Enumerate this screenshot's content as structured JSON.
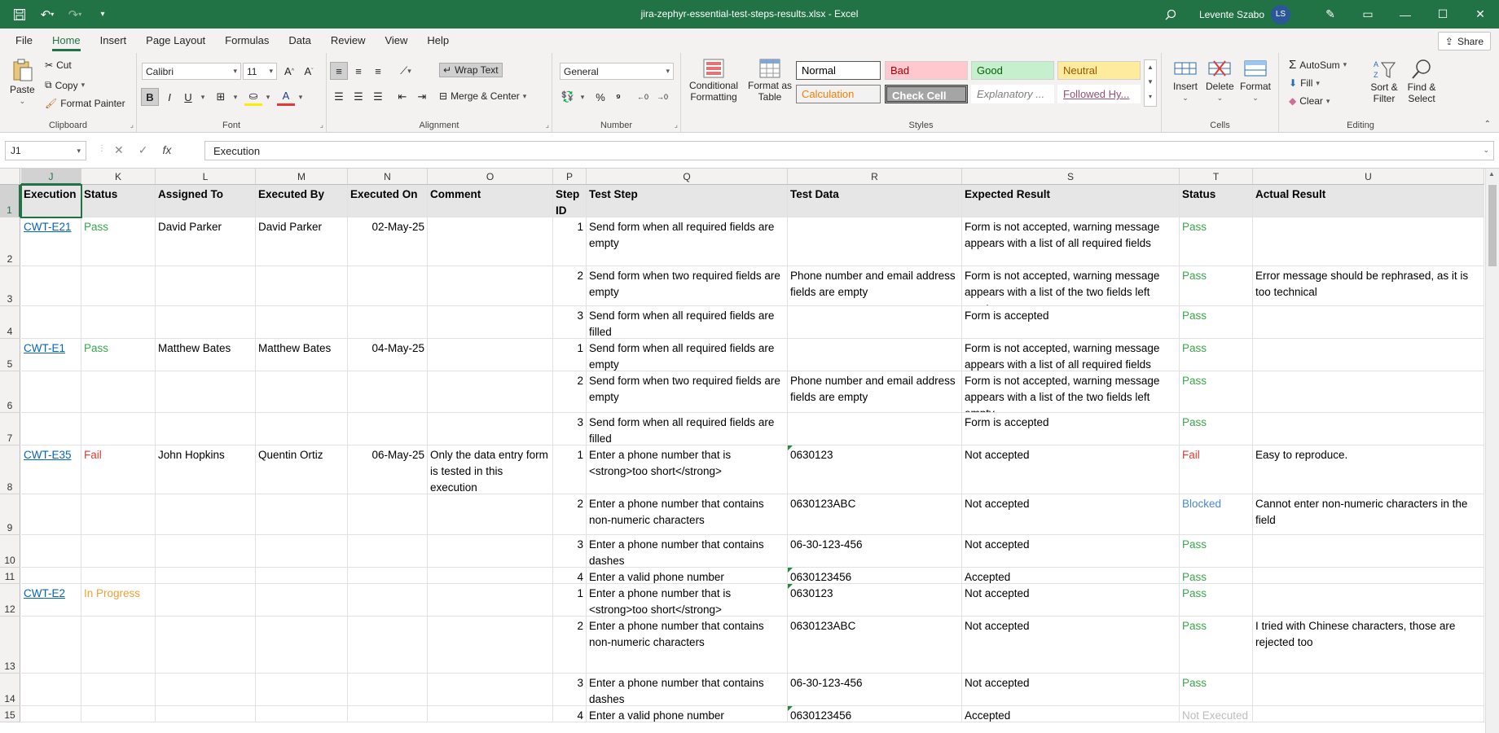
{
  "window": {
    "title": "jira-zephyr-essential-test-steps-results.xlsx  -  Excel",
    "user_name": "Levente Szabo",
    "user_initials": "LS"
  },
  "menu": {
    "tabs": [
      "File",
      "Home",
      "Insert",
      "Page Layout",
      "Formulas",
      "Data",
      "Review",
      "View",
      "Help"
    ],
    "active": "Home",
    "share_label": "Share"
  },
  "ribbon": {
    "clipboard": {
      "paste": "Paste",
      "cut": "Cut",
      "copy": "Copy",
      "format_painter": "Format Painter",
      "label": "Clipboard"
    },
    "font": {
      "family": "Calibri",
      "size": "11",
      "label": "Font"
    },
    "alignment": {
      "wrap_text": "Wrap Text",
      "merge_center": "Merge & Center",
      "label": "Alignment"
    },
    "number": {
      "format": "General",
      "label": "Number"
    },
    "styles": {
      "conditional_formatting": "Conditional Formatting",
      "format_as_table": "Format as Table",
      "normal": "Normal",
      "bad": "Bad",
      "good": "Good",
      "neutral": "Neutral",
      "calculation": "Calculation",
      "check_cell": "Check Cell",
      "explanatory": "Explanatory ...",
      "followed": "Followed Hy...",
      "label": "Styles"
    },
    "cells": {
      "insert": "Insert",
      "delete": "Delete",
      "format": "Format",
      "label": "Cells"
    },
    "editing": {
      "autosum": "AutoSum",
      "fill": "Fill",
      "clear": "Clear",
      "sort_filter": "Sort & Filter",
      "find_select": "Find & Select",
      "label": "Editing"
    }
  },
  "formula_bar": {
    "name_box": "J1",
    "content": "Execution"
  },
  "sheet": {
    "columns": [
      {
        "letter": "J",
        "header": "Execution"
      },
      {
        "letter": "K",
        "header": "Status"
      },
      {
        "letter": "L",
        "header": "Assigned To"
      },
      {
        "letter": "M",
        "header": "Executed By"
      },
      {
        "letter": "N",
        "header": "Executed On"
      },
      {
        "letter": "O",
        "header": "Comment"
      },
      {
        "letter": "P",
        "header": "Step ID"
      },
      {
        "letter": "Q",
        "header": "Test Step"
      },
      {
        "letter": "R",
        "header": "Test Data"
      },
      {
        "letter": "S",
        "header": "Expected Result"
      },
      {
        "letter": "T",
        "header": "Status"
      },
      {
        "letter": "U",
        "header": "Actual Result"
      }
    ],
    "rows": [
      {
        "num": "2",
        "J": "CWT-E21",
        "K": "Pass",
        "L": "David Parker",
        "M": "David Parker",
        "N": "02-May-25",
        "O": "",
        "P": "1",
        "Q": "Send form when all required fields are empty",
        "R": "",
        "S": "Form is not accepted, warning message appears with a list of all required fields",
        "T": "Pass",
        "U": ""
      },
      {
        "num": "3",
        "J": "",
        "K": "",
        "L": "",
        "M": "",
        "N": "",
        "O": "",
        "P": "2",
        "Q": "Send form when two required fields are empty",
        "R": "Phone number and email address fields are empty",
        "S": "Form is not accepted, warning message appears with a list of the two fields left empty",
        "T": "Pass",
        "U": "Error message should be rephrased, as it is too technical"
      },
      {
        "num": "4",
        "J": "",
        "K": "",
        "L": "",
        "M": "",
        "N": "",
        "O": "",
        "P": "3",
        "Q": "Send form when all required fields are filled",
        "R": "",
        "S": "Form is accepted",
        "T": "Pass",
        "U": ""
      },
      {
        "num": "5",
        "J": "CWT-E1",
        "K": "Pass",
        "L": "Matthew Bates",
        "M": "Matthew Bates",
        "N": "04-May-25",
        "O": "",
        "P": "1",
        "Q": "Send form when all required fields are empty",
        "R": "",
        "S": "Form is not accepted, warning message appears with a list of all required fields",
        "T": "Pass",
        "U": ""
      },
      {
        "num": "6",
        "J": "",
        "K": "",
        "L": "",
        "M": "",
        "N": "",
        "O": "",
        "P": "2",
        "Q": "Send form when two required fields are empty",
        "R": "Phone number and email address fields are empty",
        "S": "Form is not accepted, warning message appears with a list of the two fields left empty",
        "T": "Pass",
        "U": ""
      },
      {
        "num": "7",
        "J": "",
        "K": "",
        "L": "",
        "M": "",
        "N": "",
        "O": "",
        "P": "3",
        "Q": "Send form when all required fields are filled",
        "R": "",
        "S": "Form is accepted",
        "T": "Pass",
        "U": ""
      },
      {
        "num": "8",
        "J": "CWT-E35",
        "K": "Fail",
        "L": "John Hopkins",
        "M": "Quentin Ortiz",
        "N": "06-May-25",
        "O": "Only the data entry form is tested in this execution",
        "P": "1",
        "Q": "Enter a phone number that is <strong>too short</strong>",
        "R": "0630123",
        "S": "Not accepted",
        "T": "Fail",
        "U": "Easy to reproduce."
      },
      {
        "num": "9",
        "J": "",
        "K": "",
        "L": "",
        "M": "",
        "N": "",
        "O": "",
        "P": "2",
        "Q": "Enter a phone number that contains non-numeric characters",
        "R": "0630123ABC",
        "S": "Not accepted",
        "T": "Blocked",
        "U": "Cannot enter non-numeric characters in the field"
      },
      {
        "num": "10",
        "J": "",
        "K": "",
        "L": "",
        "M": "",
        "N": "",
        "O": "",
        "P": "3",
        "Q": "Enter a phone number that contains dashes",
        "R": "06-30-123-456",
        "S": "Not accepted",
        "T": "Pass",
        "U": ""
      },
      {
        "num": "11",
        "J": "",
        "K": "",
        "L": "",
        "M": "",
        "N": "",
        "O": "",
        "P": "4",
        "Q": "Enter a valid phone number",
        "R": "0630123456",
        "S": "Accepted",
        "T": "Pass",
        "U": ""
      },
      {
        "num": "12",
        "J": "CWT-E2",
        "K": "In Progress",
        "L": "",
        "M": "",
        "N": "",
        "O": "",
        "P": "1",
        "Q": "Enter a phone number that is <strong>too short</strong>",
        "R": "0630123",
        "S": "Not accepted",
        "T": "Pass",
        "U": ""
      },
      {
        "num": "13",
        "J": "",
        "K": "",
        "L": "",
        "M": "",
        "N": "",
        "O": "",
        "P": "2",
        "Q": "Enter a phone number that contains non-numeric characters",
        "R": "0630123ABC",
        "S": "Not accepted",
        "T": "Pass",
        "U": "I tried with Chinese characters, those are rejected too"
      },
      {
        "num": "14",
        "J": "",
        "K": "",
        "L": "",
        "M": "",
        "N": "",
        "O": "",
        "P": "3",
        "Q": "Enter a phone number that contains dashes",
        "R": "06-30-123-456",
        "S": "Not accepted",
        "T": "Pass",
        "U": ""
      },
      {
        "num": "15",
        "J": "",
        "K": "",
        "L": "",
        "M": "",
        "N": "",
        "O": "",
        "P": "4",
        "Q": "Enter a valid phone number",
        "R": "0630123456",
        "S": "Accepted",
        "T": "Not Executed",
        "U": ""
      }
    ]
  },
  "status_colors": {
    "pass": "#3aa84c",
    "fail": "#e53935",
    "blocked": "#4a86d6",
    "in_progress": "#f0a030",
    "not_executed": "#bdbdbd",
    "accent": "#217346"
  }
}
